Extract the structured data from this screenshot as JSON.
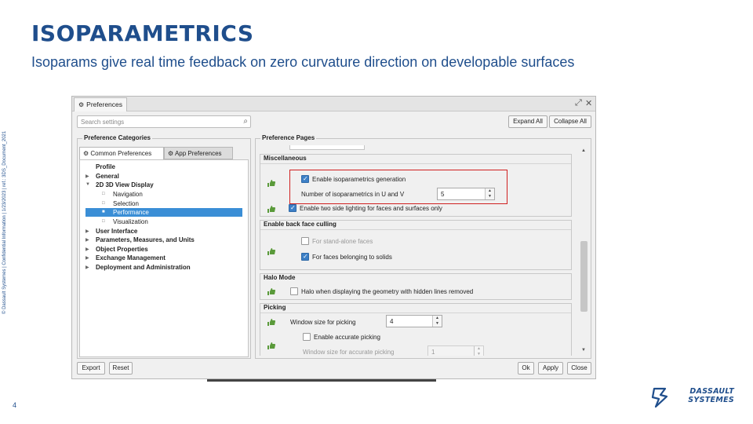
{
  "slide": {
    "title": "ISOPARAMETRICS",
    "subtitle": "Isoparams give real time feedback on zero curvature direction on developable surfaces",
    "side_note": "© Dassault Systemes | Confidential Information | 1/23/2023 | ref.: 3DS_Document_2021",
    "page_number": "4",
    "logo_line1": "DASSAULT",
    "logo_line2": "SYSTEMES"
  },
  "dialog": {
    "tab_title": "Preferences",
    "search_placeholder": "Search settings",
    "expand_all": "Expand All",
    "collapse_all": "Collapse All",
    "categories_label": "Preference Categories",
    "tabs": [
      "Common Preferences",
      "App Preferences"
    ],
    "tree": [
      {
        "label": "Profile"
      },
      {
        "label": "General"
      },
      {
        "label": "2D 3D View Display"
      },
      {
        "label": "Navigation"
      },
      {
        "label": "Selection"
      },
      {
        "label": "Performance"
      },
      {
        "label": "Visualization"
      },
      {
        "label": "User Interface"
      },
      {
        "label": "Parameters, Measures, and Units"
      },
      {
        "label": "Object Properties"
      },
      {
        "label": "Exchange Management"
      },
      {
        "label": "Deployment and Administration"
      }
    ],
    "pages_label": "Preference Pages",
    "misc": {
      "title": "Miscellaneous",
      "enable_iso": "Enable isoparametrics generation",
      "iso_count_label": "Number of isoparametrics in U and V",
      "iso_count": "5",
      "two_side": "Enable two side lighting for faces and surfaces only"
    },
    "backface": {
      "title": "Enable back face culling",
      "standalone": "For stand-alone faces",
      "solids": "For faces belonging to solids"
    },
    "halo": {
      "title": "Halo Mode",
      "label": "Halo when displaying the geometry with hidden lines removed"
    },
    "picking": {
      "title": "Picking",
      "window_label": "Window size for picking",
      "window_value": "4",
      "accurate": "Enable accurate picking",
      "accurate_window_label": "Window size for accurate picking",
      "accurate_window_value": "1"
    },
    "footer": {
      "export": "Export",
      "reset": "Reset",
      "ok": "Ok",
      "apply": "Apply",
      "close": "Close"
    }
  }
}
